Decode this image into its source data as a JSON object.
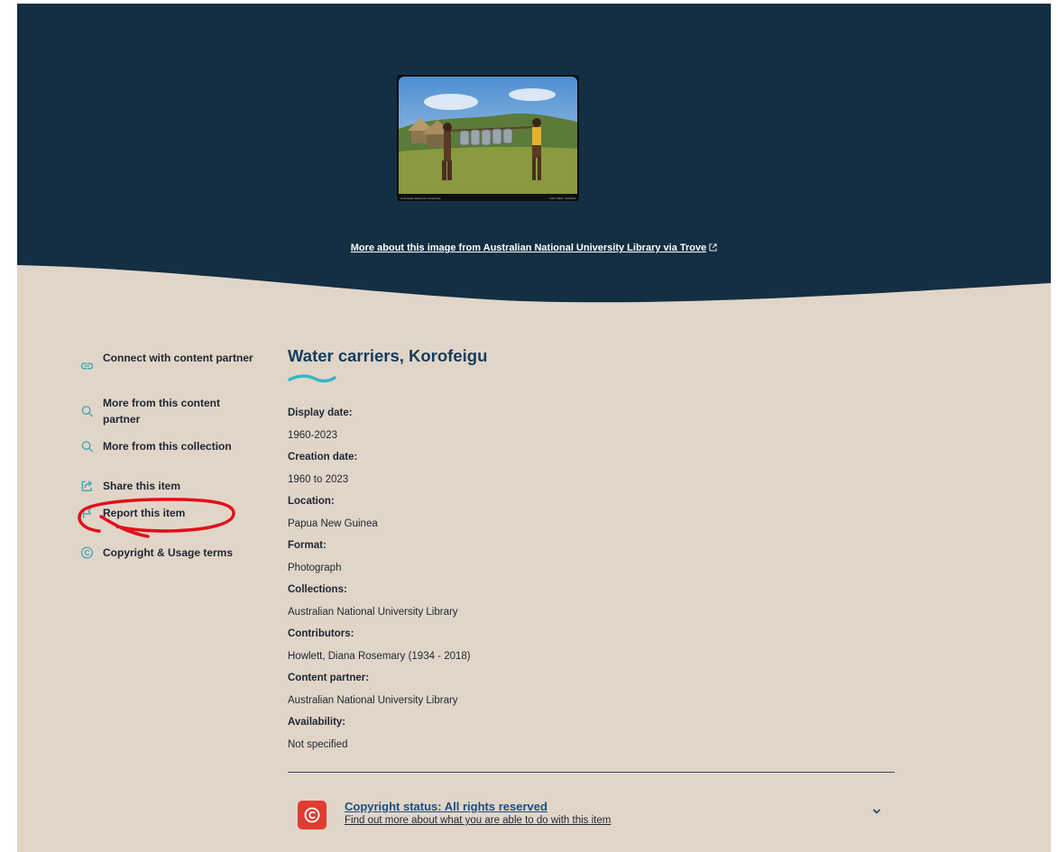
{
  "hero": {
    "photo_caption_left": "Australian National University",
    "photo_caption_right": "CAP 1060 / 104444",
    "source_link": "More about this image from Australian National University Library via Trove"
  },
  "sidebar": {
    "items": [
      {
        "label": "Connect with content partner",
        "icon": "link-icon"
      },
      {
        "label": "More from this content partner",
        "icon": "search-icon"
      },
      {
        "label": "More from this collection",
        "icon": "search-icon"
      },
      {
        "label": "Share this item",
        "icon": "share-icon"
      },
      {
        "label": "Report this item",
        "icon": "flag-icon"
      },
      {
        "label": "Copyright & Usage terms",
        "icon": "copyright-icon"
      }
    ]
  },
  "item": {
    "title": "Water carriers, Korofeigu",
    "fields": [
      {
        "label": "Display date:",
        "value": "1960-2023"
      },
      {
        "label": "Creation date:",
        "value": "1960 to 2023"
      },
      {
        "label": "Location:",
        "value": "Papua New Guinea"
      },
      {
        "label": "Format:",
        "value": "Photograph"
      },
      {
        "label": "Collections:",
        "value": "Australian National University Library"
      },
      {
        "label": "Contributors:",
        "value": "Howlett, Diana Rosemary (1934 - 2018)"
      },
      {
        "label": "Content partner:",
        "value": "Australian National University Library"
      },
      {
        "label": "Availability:",
        "value": "Not specified"
      }
    ]
  },
  "copyright": {
    "title": "Copyright status: All rights reserved",
    "subtitle": "Find out more about what you are able to do with this item"
  },
  "colors": {
    "hero_navy": "#142f42",
    "page_beige": "#e1d5c8",
    "title_blue": "#143c5c",
    "accent_teal": "#39b6c2",
    "copyright_red": "#e03c31",
    "annotation_red": "#e0101b"
  }
}
